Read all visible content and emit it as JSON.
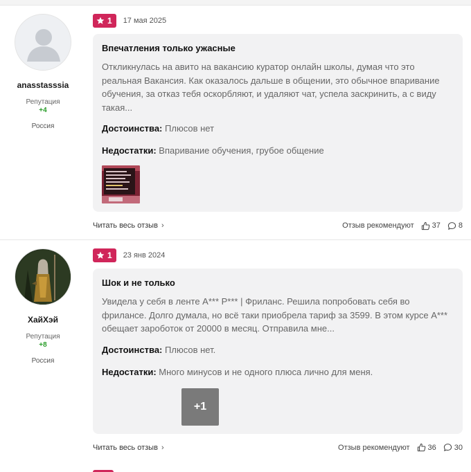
{
  "reviews": [
    {
      "author": "anasstasssia",
      "reputation_label": "Репутация",
      "reputation_value": "+4",
      "country": "Россия",
      "rating": "1",
      "date": "17 мая 2025",
      "title": "Впечатления только ужасные",
      "text": "Откликнулась на авито на вакансию куратор онлайн школы, думая что это реальная Вакансия. Как оказалось дальше в общении, это обычное впаривание обучения, за отказ тебя оскорбляют, и удаляют чат, успела заскринить, а с виду такая...",
      "pros_label": "Достоинства:",
      "pros": "Плюсов нет",
      "cons_label": "Недостатки:",
      "cons": "Впаривание обучения, грубое общение",
      "read_more": "Читать весь отзыв",
      "recommend_label": "Отзыв рекомендуют",
      "likes": "37",
      "comments": "8"
    },
    {
      "author": "ХайХэй",
      "reputation_label": "Репутация",
      "reputation_value": "+8",
      "country": "Россия",
      "rating": "1",
      "date": "23 янв 2024",
      "title": "Шок и не только",
      "text": "Увидела у себя в ленте А*** Р*** | Фриланс. Решила попробовать себя во фрилансе. Долго думала, но всё таки приобрела тариф за 3599. В этом курсе А*** обещает зароботок от 20000 в месяц. Отправила мне...",
      "pros_label": "Достоинства:",
      "pros": "Плюсов нет.",
      "cons_label": "Недостатки:",
      "cons": "Много минусов и не одного плюса лично для меня.",
      "more_photos": "+1",
      "read_more": "Читать весь отзыв",
      "recommend_label": "Отзыв рекомендуют",
      "likes": "36",
      "comments": "30"
    }
  ],
  "colors": {
    "rating_badge": "#d0265a",
    "reputation_positive": "#2a9d2a",
    "card_background": "#f2f2f3"
  },
  "icons": [
    "star-icon",
    "chevron-right-icon",
    "thumbs-up-icon",
    "comment-icon"
  ]
}
